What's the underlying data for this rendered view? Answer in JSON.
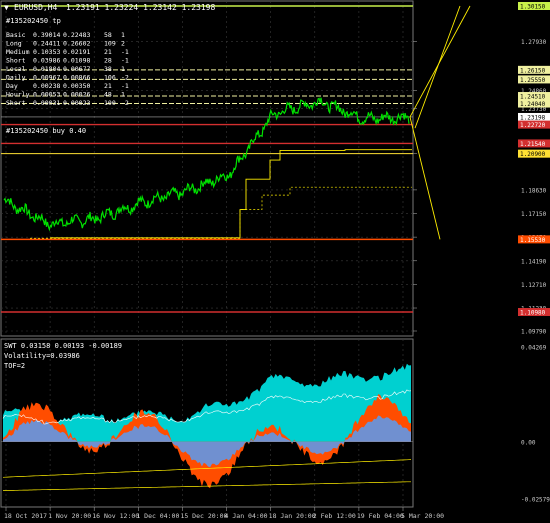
{
  "header": {
    "symbol": "EURUSD,H4",
    "ohlc": "1.23191 1.23224 1.23142 1.23198",
    "position_label": "#135202450 tp",
    "buy_label": "#135202450 buy 0.40"
  },
  "stats_table": [
    [
      "Basic",
      "0.39014",
      "0.22483",
      "58",
      "1"
    ],
    [
      "Long",
      "0.24411",
      "0.26602",
      "109",
      "2"
    ],
    [
      "Medium",
      "0.10353",
      "0.02191",
      "21",
      "-1"
    ],
    [
      "Short",
      "0.03986",
      "0.01098",
      "28",
      "-1"
    ],
    [
      "Local",
      "0.01804",
      "0.00677",
      "38",
      "1"
    ],
    [
      "Daily",
      "0.00967",
      "0.00866",
      "106",
      "-2"
    ],
    [
      "Day",
      "0.00238",
      "0.00350",
      "21",
      "-1"
    ],
    [
      "Hourly",
      "0.00053",
      "0.00026",
      "48",
      "1"
    ],
    [
      "Short",
      "0.00031",
      "0.00023",
      "100",
      "-2"
    ]
  ],
  "price_axis": {
    "ticks": [
      "1.27930",
      "1.24860",
      "1.23730",
      "1.20900",
      "1.18630",
      "1.17150",
      "1.15670",
      "1.14190",
      "1.12710",
      "1.11230",
      "1.09790"
    ],
    "price_ticks": [
      1.2793,
      1.2486,
      1.2373,
      1.209,
      1.1863,
      1.1715,
      1.1567,
      1.1419,
      1.1271,
      1.1123,
      1.0979
    ],
    "tags": [
      {
        "label": "1.30150",
        "price": 1.3015,
        "bg": "#c8f04a",
        "fg": "#000000"
      },
      {
        "label": "1.26150",
        "price": 1.2615,
        "bg": "#f0f0a0",
        "fg": "#000000"
      },
      {
        "label": "1.25550",
        "price": 1.2555,
        "bg": "#f0f0a0",
        "fg": "#000000"
      },
      {
        "label": "1.24510",
        "price": 1.2451,
        "bg": "#f0f0a0",
        "fg": "#000000"
      },
      {
        "label": "1.24040",
        "price": 1.2404,
        "bg": "#f0f0a0",
        "fg": "#000000"
      },
      {
        "label": "1.23198",
        "price": 1.23198,
        "bg": "#ffffff",
        "fg": "#000000"
      },
      {
        "label": "1.22720",
        "price": 1.2272,
        "bg": "#d32f2f",
        "fg": "#ffffff"
      },
      {
        "label": "1.21540",
        "price": 1.2154,
        "bg": "#d32f2f",
        "fg": "#ffffff"
      },
      {
        "label": "1.20900",
        "price": 1.209,
        "bg": "#ffe033",
        "fg": "#000000"
      },
      {
        "label": "1.15530",
        "price": 1.1553,
        "bg": "#ff4d00",
        "fg": "#ffffff"
      },
      {
        "label": "1.10980",
        "price": 1.1098,
        "bg": "#d32f2f",
        "fg": "#ffffff"
      }
    ]
  },
  "indicator": {
    "name": "SWT 0.03158 0.00193 -0.00189",
    "volatility": "Volatility=0.03986",
    "tof": "TOF=2",
    "axis_ticks": [
      "0.04269",
      "0.00",
      "-0.02579"
    ],
    "axis_values": [
      0.04269,
      0,
      -0.02579
    ]
  },
  "time_axis": [
    "18 Oct 2017",
    "1 Nov 20:00",
    "16 Nov 12:00",
    "1 Dec 04:00",
    "15 Dec 20:00",
    "4 Jan 04:00",
    "18 Jan 20:00",
    "2 Feb 12:00",
    "19 Feb 04:00",
    "5 Mar 20:00"
  ],
  "colors": {
    "price_line": "#00e000",
    "indicator_cyan": "#00d0d0",
    "indicator_orange": "#ff4d00",
    "indicator_blue": "#7090d0",
    "grid": "#3a3a3a",
    "level_yellow": "#ffee00"
  },
  "chart_data": [
    {
      "type": "line",
      "title": "EURUSD,H4",
      "x": [
        "18 Oct 2017",
        "1 Nov 20:00",
        "16 Nov 12:00",
        "1 Dec 04:00",
        "15 Dec 20:00",
        "4 Jan 04:00",
        "18 Jan 20:00",
        "2 Feb 12:00",
        "19 Feb 04:00",
        "5 Mar 20:00"
      ],
      "series": [
        {
          "values": [
            1.18,
            1.165,
            1.168,
            1.178,
            1.185,
            1.196,
            1.234,
            1.242,
            1.231,
            1.232
          ]
        }
      ],
      "ylim": [
        1.0979,
        1.3015
      ],
      "grid": true
    },
    {
      "type": "area",
      "title": "SWT",
      "x": [
        "18 Oct 2017",
        "1 Nov 20:00",
        "16 Nov 12:00",
        "1 Dec 04:00",
        "15 Dec 20:00",
        "4 Jan 04:00",
        "18 Jan 20:00",
        "2 Feb 12:00",
        "19 Feb 04:00",
        "5 Mar 20:00"
      ],
      "series": [
        {
          "values": [
            0.013,
            0.01,
            0.011,
            0.012,
            0.012,
            0.017,
            0.028,
            0.027,
            0.03,
            0.032
          ]
        }
      ],
      "ylim": [
        -0.02579,
        0.04269
      ]
    }
  ]
}
